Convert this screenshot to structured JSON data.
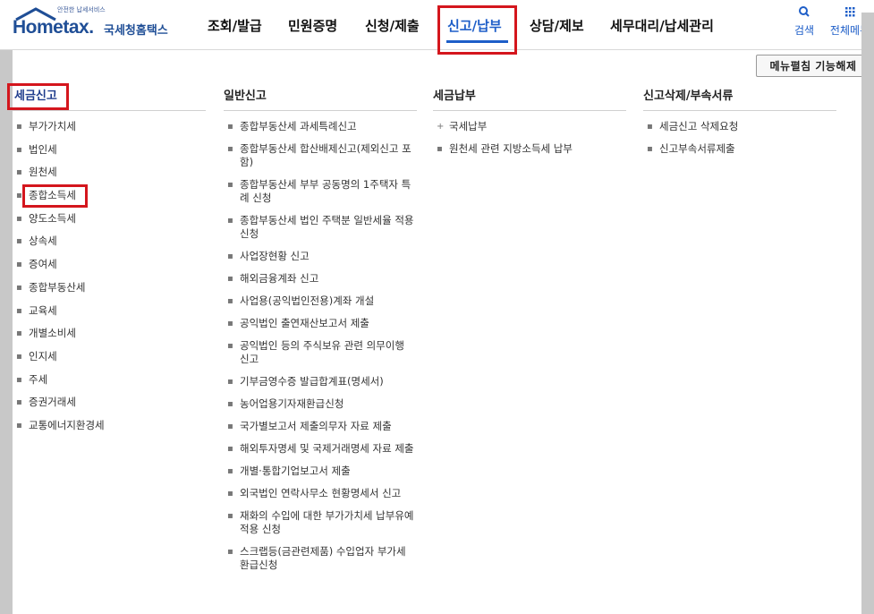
{
  "brand": {
    "small_text": "안전한 납세서비스",
    "logo_text": "Hometax.",
    "agency": "국세청홈택스"
  },
  "gnb": [
    {
      "label": "조회/발급"
    },
    {
      "label": "민원증명"
    },
    {
      "label": "신청/제출"
    },
    {
      "label": "신고/납부"
    },
    {
      "label": "상담/제보"
    },
    {
      "label": "세무대리/납세관리"
    }
  ],
  "util": {
    "search_label": "검색",
    "all_menu_label": "전체메뉴"
  },
  "menu_close_label": "메뉴펼침 기능해제",
  "columns": {
    "tax_report": {
      "title": "세금신고",
      "items": [
        "부가가치세",
        "법인세",
        "원천세",
        "종합소득세",
        "양도소득세",
        "상속세",
        "증여세",
        "종합부동산세",
        "교육세",
        "개별소비세",
        "인지세",
        "주세",
        "증권거래세",
        "교통에너지환경세"
      ]
    },
    "general_report": {
      "title": "일반신고",
      "items": [
        "종합부동산세 과세특례신고",
        "종합부동산세 합산배제신고(제외신고 포함)",
        "종합부동산세 부부 공동명의 1주택자 특례 신청",
        "종합부동산세 법인 주택분 일반세율 적용 신청",
        "사업장현황 신고",
        "해외금융계좌 신고",
        "사업용(공익법인전용)계좌 개설",
        "공익법인 출연재산보고서 제출",
        "공익법인 등의 주식보유 관련 의무이행 신고",
        "기부금영수증 발급합계표(명세서)",
        "농어업용기자재환급신청",
        "국가별보고서 제출의무자 자료 제출",
        "해외투자명세 및 국제거래명세 자료 제출",
        "개별·통합기업보고서 제출",
        "외국법인 연락사무소 현황명세서 신고",
        "재화의 수입에 대한 부가가치세 납부유예 적용 신청",
        "스크랩등(금관련제품) 수입업자 부가세 환급신청"
      ]
    },
    "tax_payment": {
      "title": "세금납부",
      "items": [
        "국세납부",
        "원천세 관련 지방소득세 납부"
      ]
    },
    "report_delete": {
      "title": "신고삭제/부속서류",
      "items": [
        "세금신고 삭제요청",
        "신고부속서류제출"
      ]
    }
  },
  "colors": {
    "accent": "#1e5ec8",
    "highlight_box": "#d4161d",
    "brand": "#1f4e96"
  }
}
